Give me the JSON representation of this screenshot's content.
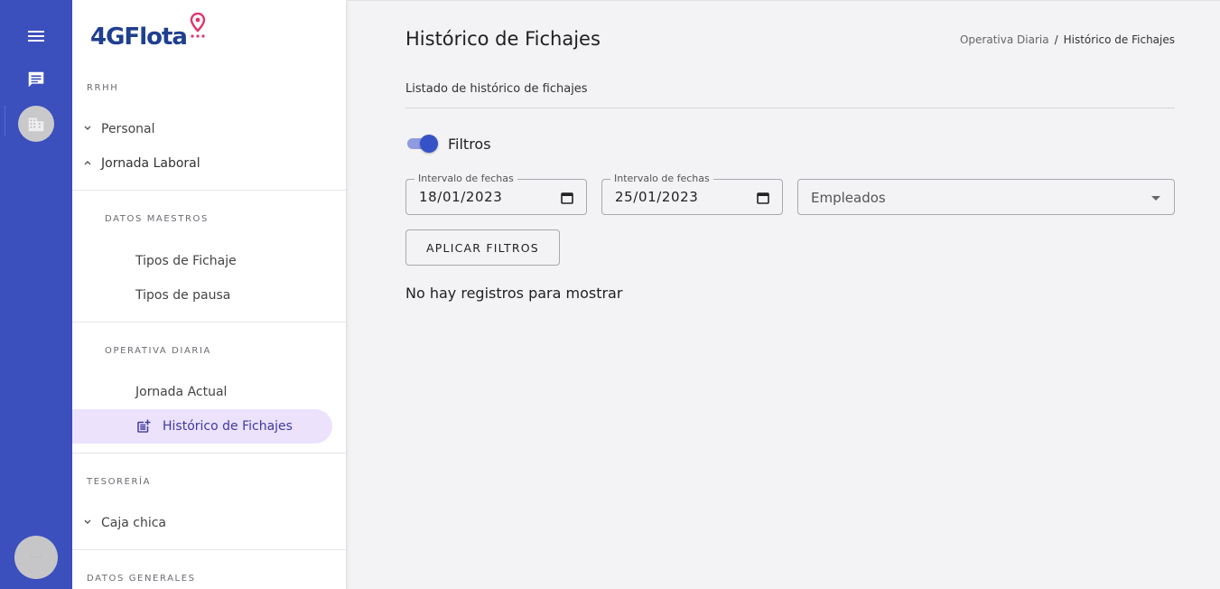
{
  "rail": {
    "icons": [
      "menu-icon",
      "chat-icon",
      "building-icon"
    ],
    "user_avatar_text": "·· ·· ··"
  },
  "brand": {
    "logo_text": "4GFlota"
  },
  "sidebar": {
    "sections": [
      {
        "label": "RRHH"
      },
      {
        "label": "DATOS MAESTROS"
      },
      {
        "label": "OPERATIVA DIARIA"
      },
      {
        "label": "TESORERÍA"
      },
      {
        "label": "DATOS GENERALES"
      }
    ],
    "items": {
      "personal": "Personal",
      "jornada_laboral": "Jornada Laboral",
      "tipos_fichaje": "Tipos de Fichaje",
      "tipos_pausa": "Tipos de pausa",
      "jornada_actual": "Jornada Actual",
      "historico_fichajes": "Histórico de Fichajes",
      "caja_chica": "Caja chica"
    }
  },
  "page": {
    "title": "Histórico de Fichajes",
    "breadcrumb": [
      "Operativa Diaria",
      "Histórico de Fichajes"
    ],
    "breadcrumb_separator": "/",
    "subtitle": "Listado de histórico de fichajes"
  },
  "filters": {
    "toggle_label": "Filtros",
    "toggle_on": true,
    "date_from": {
      "label": "Intervalo de fechas",
      "value": "18/01/2023"
    },
    "date_to": {
      "label": "Intervalo de fechas",
      "value": "25/01/2023"
    },
    "employees": {
      "placeholder": "Empleados"
    },
    "apply_label": "APLICAR FILTROS"
  },
  "results": {
    "empty_message": "No hay registros para mostrar"
  },
  "colors": {
    "rail_bg": "#3b4fbd",
    "accent": "#3652c7",
    "active_bg": "#ece2fb",
    "active_text": "#3e3aa3",
    "logo": "#1f3f8f",
    "pin": "#e0346b"
  }
}
